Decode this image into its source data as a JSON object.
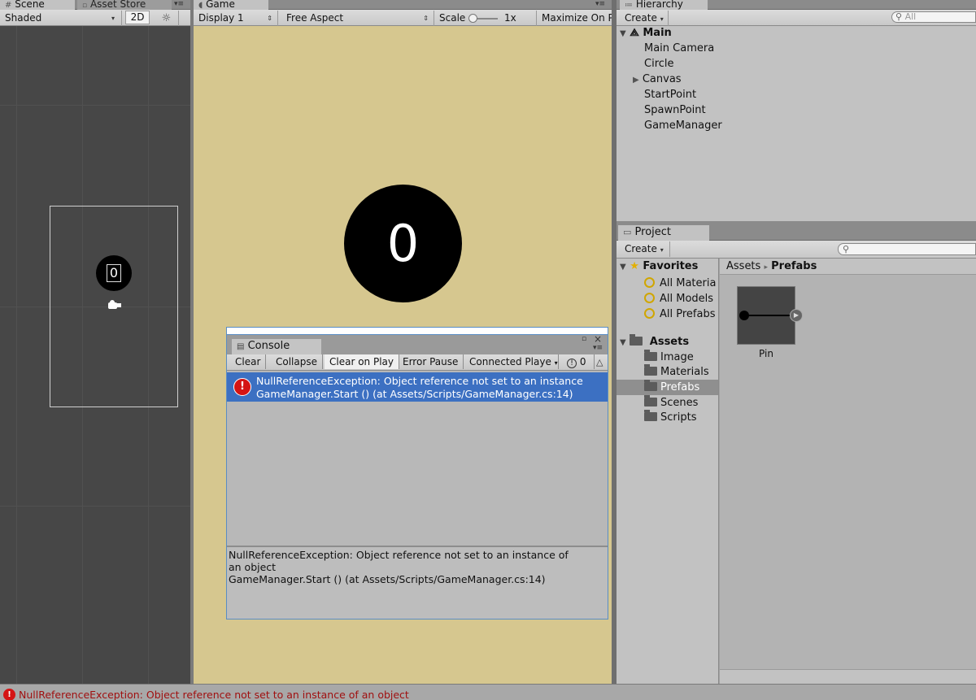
{
  "scene_panel": {
    "tabs": [
      {
        "label": "Scene"
      },
      {
        "label": "Asset Store"
      }
    ],
    "shading_mode": "Shaded",
    "mode_2d": "2D",
    "sun_icon": "sun-icon",
    "score_text": "0"
  },
  "game_panel": {
    "tab": "Game",
    "display": "Display 1",
    "aspect": "Free Aspect",
    "scale_label": "Scale",
    "scale_value": "1x",
    "maximize": "Maximize On P",
    "score": "0",
    "background_color": "#d6c78f"
  },
  "hierarchy": {
    "tab": "Hierarchy",
    "create_label": "Create",
    "search_placeholder": "All",
    "scene_name": "Main",
    "items": [
      {
        "label": "Main Camera"
      },
      {
        "label": "Circle"
      },
      {
        "label": "Canvas"
      },
      {
        "label": "StartPoint"
      },
      {
        "label": "SpawnPoint"
      },
      {
        "label": "GameManager"
      }
    ]
  },
  "project": {
    "tab": "Project",
    "create_label": "Create",
    "favorites_label": "Favorites",
    "favorites": [
      {
        "label": "All Materia"
      },
      {
        "label": "All Models"
      },
      {
        "label": "All Prefabs"
      }
    ],
    "assets_label": "Assets",
    "folders": [
      {
        "label": "Image"
      },
      {
        "label": "Materials"
      },
      {
        "label": "Prefabs"
      },
      {
        "label": "Scenes"
      },
      {
        "label": "Scripts"
      }
    ],
    "breadcrumb_root": "Assets",
    "breadcrumb_current": "Prefabs",
    "asset_name": "Pin"
  },
  "console": {
    "tab": "Console",
    "buttons": {
      "clear": "Clear",
      "collapse": "Collapse",
      "clear_on_play": "Clear on Play",
      "error_pause": "Error Pause",
      "connected_player": "Connected Playe"
    },
    "info_count": "0",
    "log_line1": "NullReferenceException: Object reference not set to an instance",
    "log_line2": "GameManager.Start () (at Assets/Scripts/GameManager.cs:14)",
    "detail_line1": "NullReferenceException: Object reference not set to an instance of",
    "detail_line2": "an object",
    "detail_line3": "GameManager.Start () (at Assets/Scripts/GameManager.cs:14)"
  },
  "status_bar": {
    "message": "NullReferenceException: Object reference not set to an instance of an object"
  }
}
